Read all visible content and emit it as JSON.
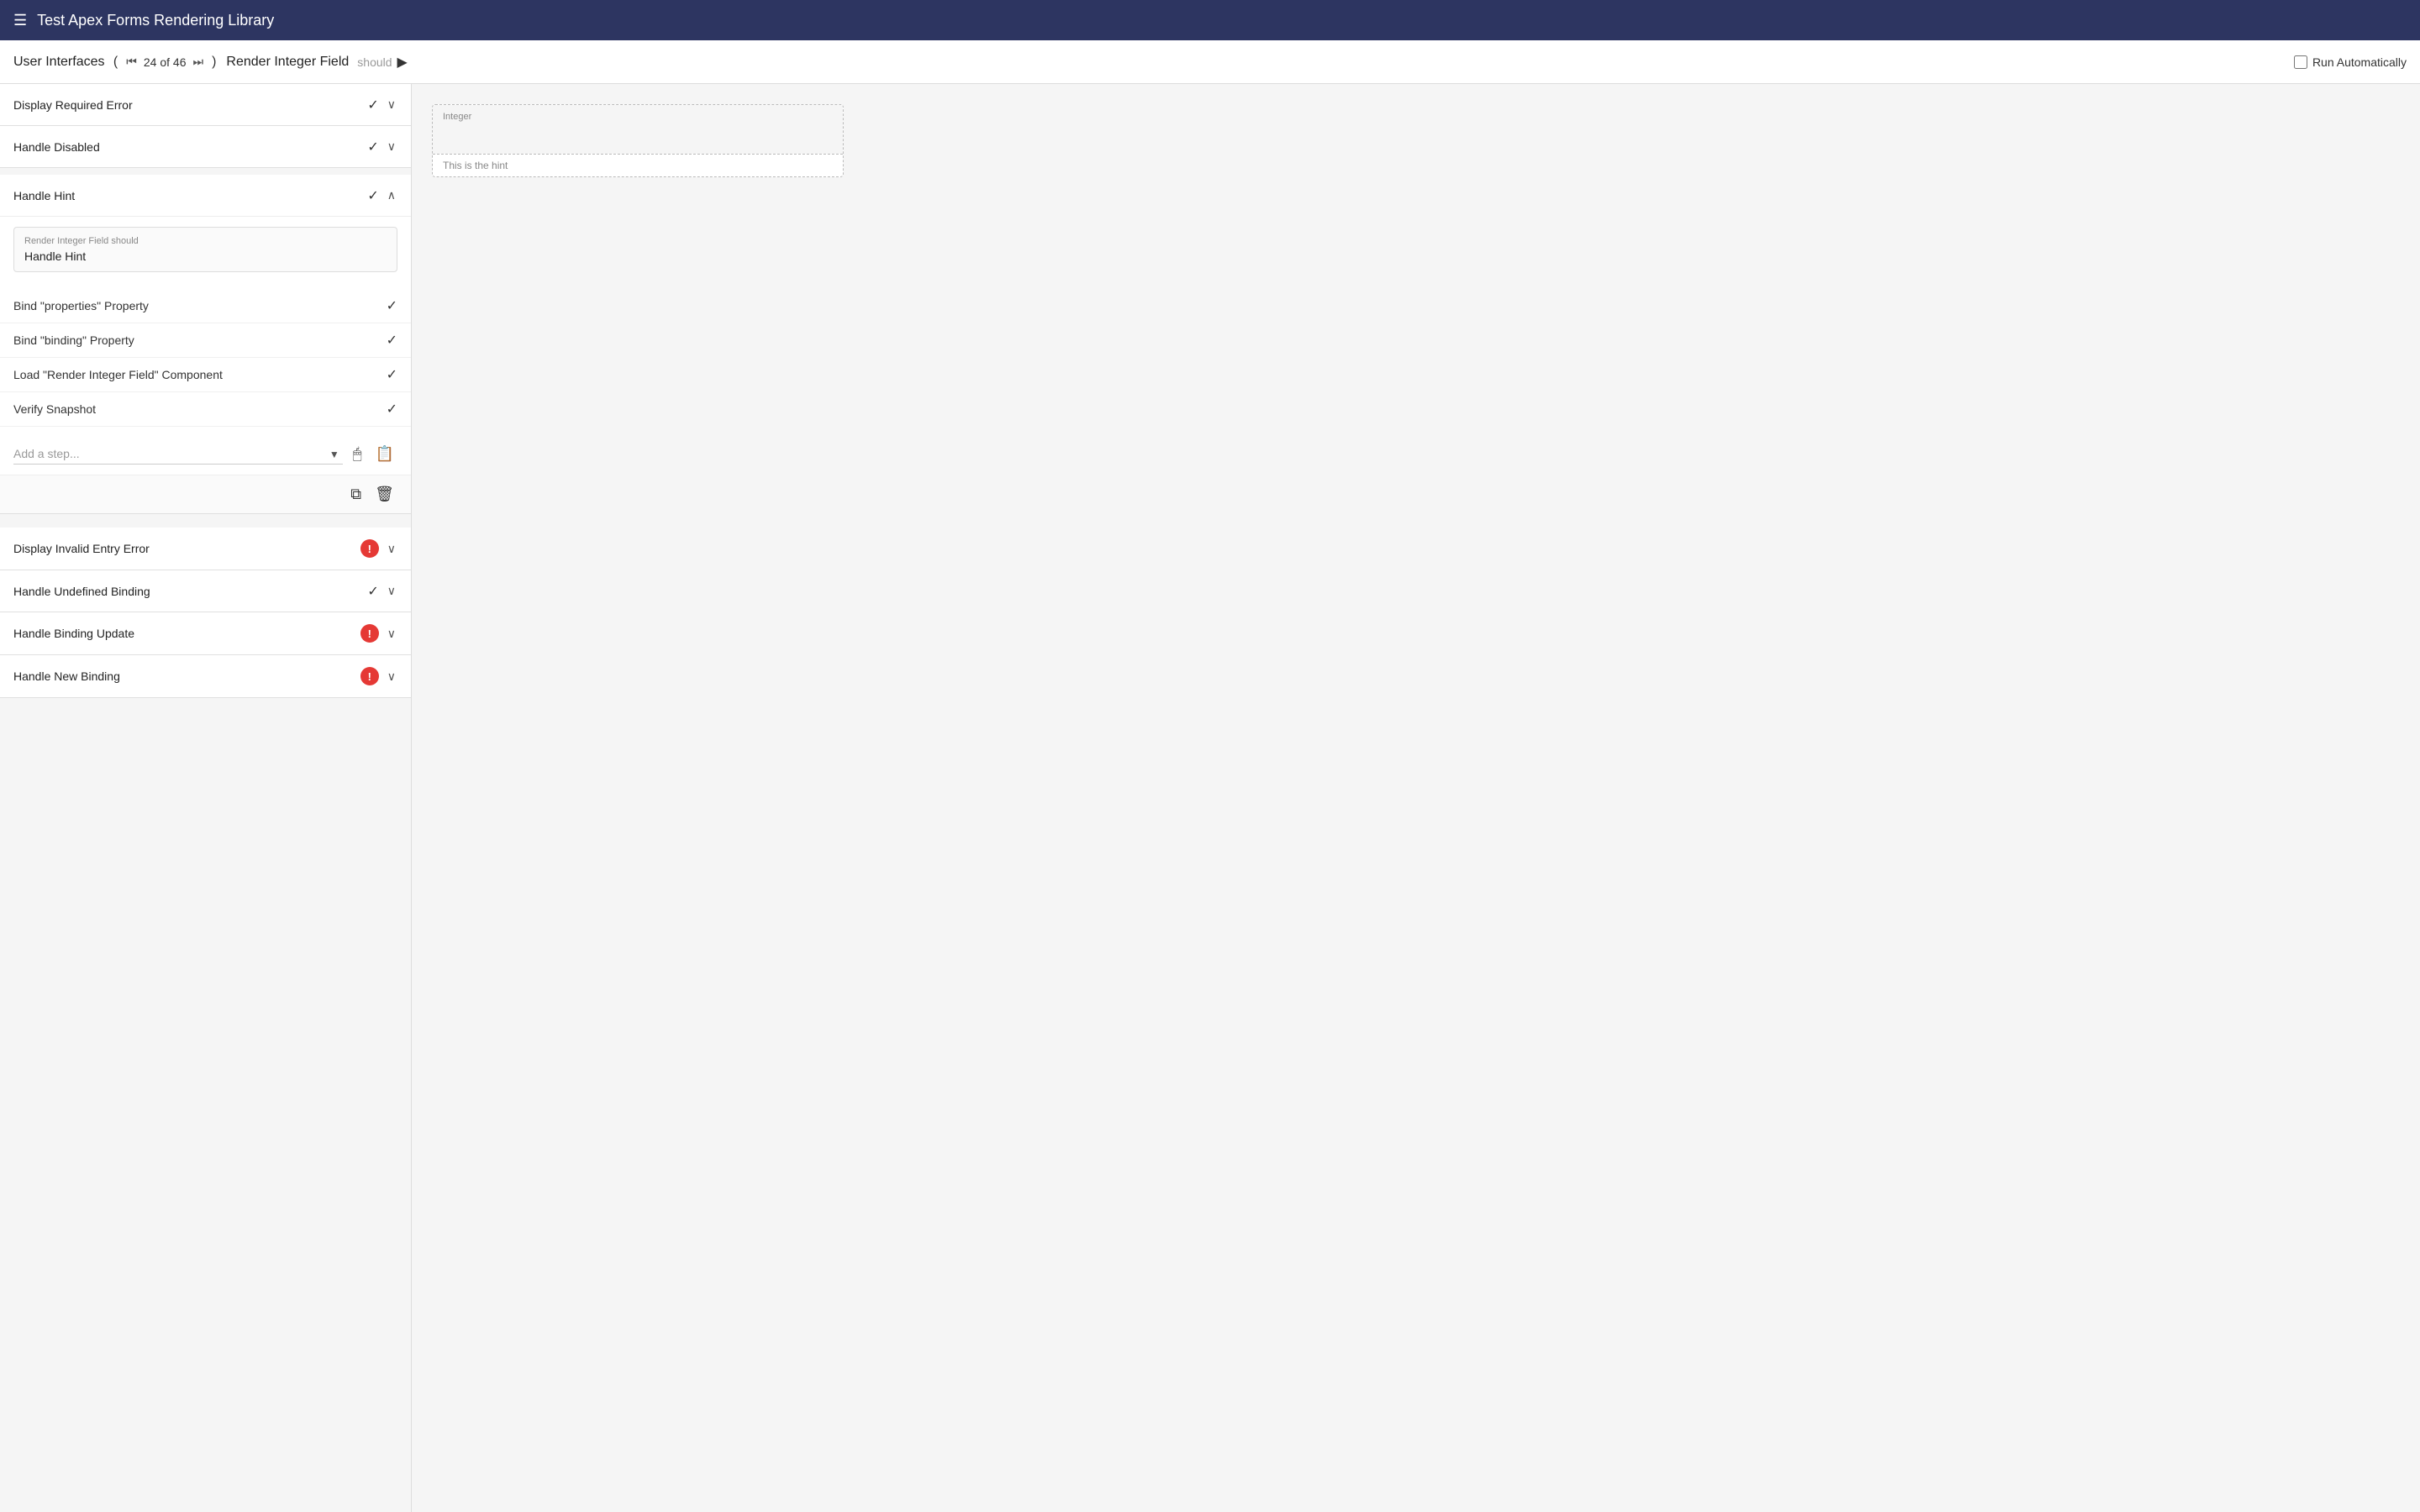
{
  "header": {
    "menu_icon": "☰",
    "title": "Test Apex Forms Rendering Library"
  },
  "subheader": {
    "section_title": "User Interfaces",
    "nav_open_paren": "(",
    "nav_first_icon": "⏮",
    "nav_position": "24 of 46",
    "nav_last_icon": "⏭",
    "nav_close_paren": ")",
    "test_title": "Render Integer Field",
    "should_label": "should",
    "play_icon": "▶",
    "run_automatically_label": "Run Automatically"
  },
  "left_panel": {
    "top_items": [
      {
        "label": "Display Required Error",
        "status": "check",
        "expanded": false
      },
      {
        "label": "Handle Disabled",
        "status": "check",
        "expanded": false
      }
    ],
    "expanded_section": {
      "label": "Handle Hint",
      "status": "check",
      "description_sub": "Render Integer Field should",
      "description_main": "Handle Hint",
      "steps": [
        {
          "label": "Bind \"properties\" Property",
          "status": "check"
        },
        {
          "label": "Bind \"binding\" Property",
          "status": "check"
        },
        {
          "label": "Load \"Render Integer Field\" Component",
          "status": "check"
        },
        {
          "label": "Verify Snapshot",
          "status": "check"
        }
      ],
      "add_step_placeholder": "Add a step...",
      "copy_icon": "⧉",
      "trash_icon": "🗑"
    },
    "bottom_items": [
      {
        "label": "Display Invalid Entry Error",
        "status": "error",
        "expanded": false
      },
      {
        "label": "Handle Undefined Binding",
        "status": "check",
        "expanded": false
      },
      {
        "label": "Handle Binding Update",
        "status": "error",
        "expanded": false
      },
      {
        "label": "Handle New Binding",
        "status": "error",
        "expanded": false
      }
    ]
  },
  "right_panel": {
    "field_label": "Integer",
    "hint_text": "This is the hint"
  }
}
